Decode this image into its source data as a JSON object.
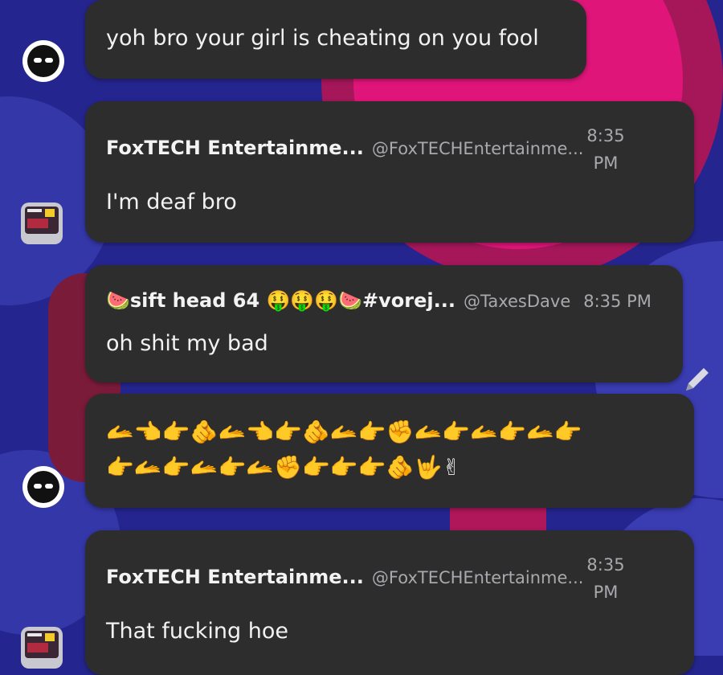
{
  "messages": [
    {
      "text": "yoh bro your girl is cheating on you fool"
    },
    {
      "author": "FoxTECH Entertainme...",
      "handle": "@FoxTECHEntertainme...",
      "time_line1": "8:35",
      "time_line2": "PM",
      "text": "I'm deaf bro"
    },
    {
      "author_prefix": "🍉",
      "author": "sift head 64 🤑🤑🤑🍉#vorej...",
      "handle": "@TaxesDave",
      "time": "8:35 PM",
      "text": "oh shit my bad"
    },
    {
      "emoji_line1": "🫴👈👉🫵🫴👈👉🫵🫴👉✊🫴👉🫴👉🫴👉",
      "emoji_line2": "👉🫴👉🫴👉🫴✊👉👉👉🫵🤟✌"
    },
    {
      "author": "FoxTECH Entertainme...",
      "handle": "@FoxTECHEntertainme...",
      "time_line1": "8:35",
      "time_line2": "PM",
      "text": "That fucking hoe"
    }
  ],
  "colors": {
    "background": "#25258f",
    "bubble": "#2d2d2e",
    "text": "#f2f2f2",
    "muted": "#a9a9ad",
    "accent_pink": "#e0157a"
  },
  "icons": [
    "edit-pencil-icon"
  ]
}
